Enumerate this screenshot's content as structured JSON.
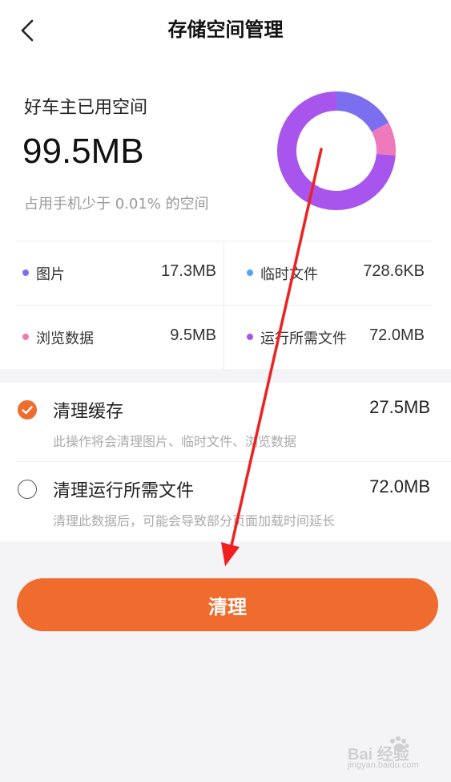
{
  "header": {
    "title": "存储空间管理"
  },
  "summary": {
    "label": "好车主已用空间",
    "value": "99.5MB",
    "note": "占用手机少于 0.01% 的空间"
  },
  "breakdown": [
    {
      "name": "图片",
      "size": "17.3MB",
      "color": "#7b6ff0",
      "fraction": 0.17
    },
    {
      "name": "临时文件",
      "size": "728.6KB",
      "color": "#4ea5f0",
      "fraction": 0.01
    },
    {
      "name": "浏览数据",
      "size": "9.5MB",
      "color": "#ee79bb",
      "fraction": 0.09
    },
    {
      "name": "运行所需文件",
      "size": "72.0MB",
      "color": "#a855ee",
      "fraction": 0.73
    }
  ],
  "options": [
    {
      "title": "清理缓存",
      "size": "27.5MB",
      "desc": "此操作将会清理图片、临时文件、浏览数据",
      "checked": true
    },
    {
      "title": "清理运行所需文件",
      "size": "72.0MB",
      "desc": "清理此数据后，可能会导致部分页面加载时间延长",
      "checked": false
    }
  ],
  "action": {
    "label": "清理"
  },
  "colors": {
    "accent": "#ef6c2e",
    "annotation": "#f02020"
  },
  "watermark": {
    "text": "jingyan.baidu.com",
    "logo": "baidu-jingyan-logo",
    "logo_text": "Bai 经验"
  }
}
